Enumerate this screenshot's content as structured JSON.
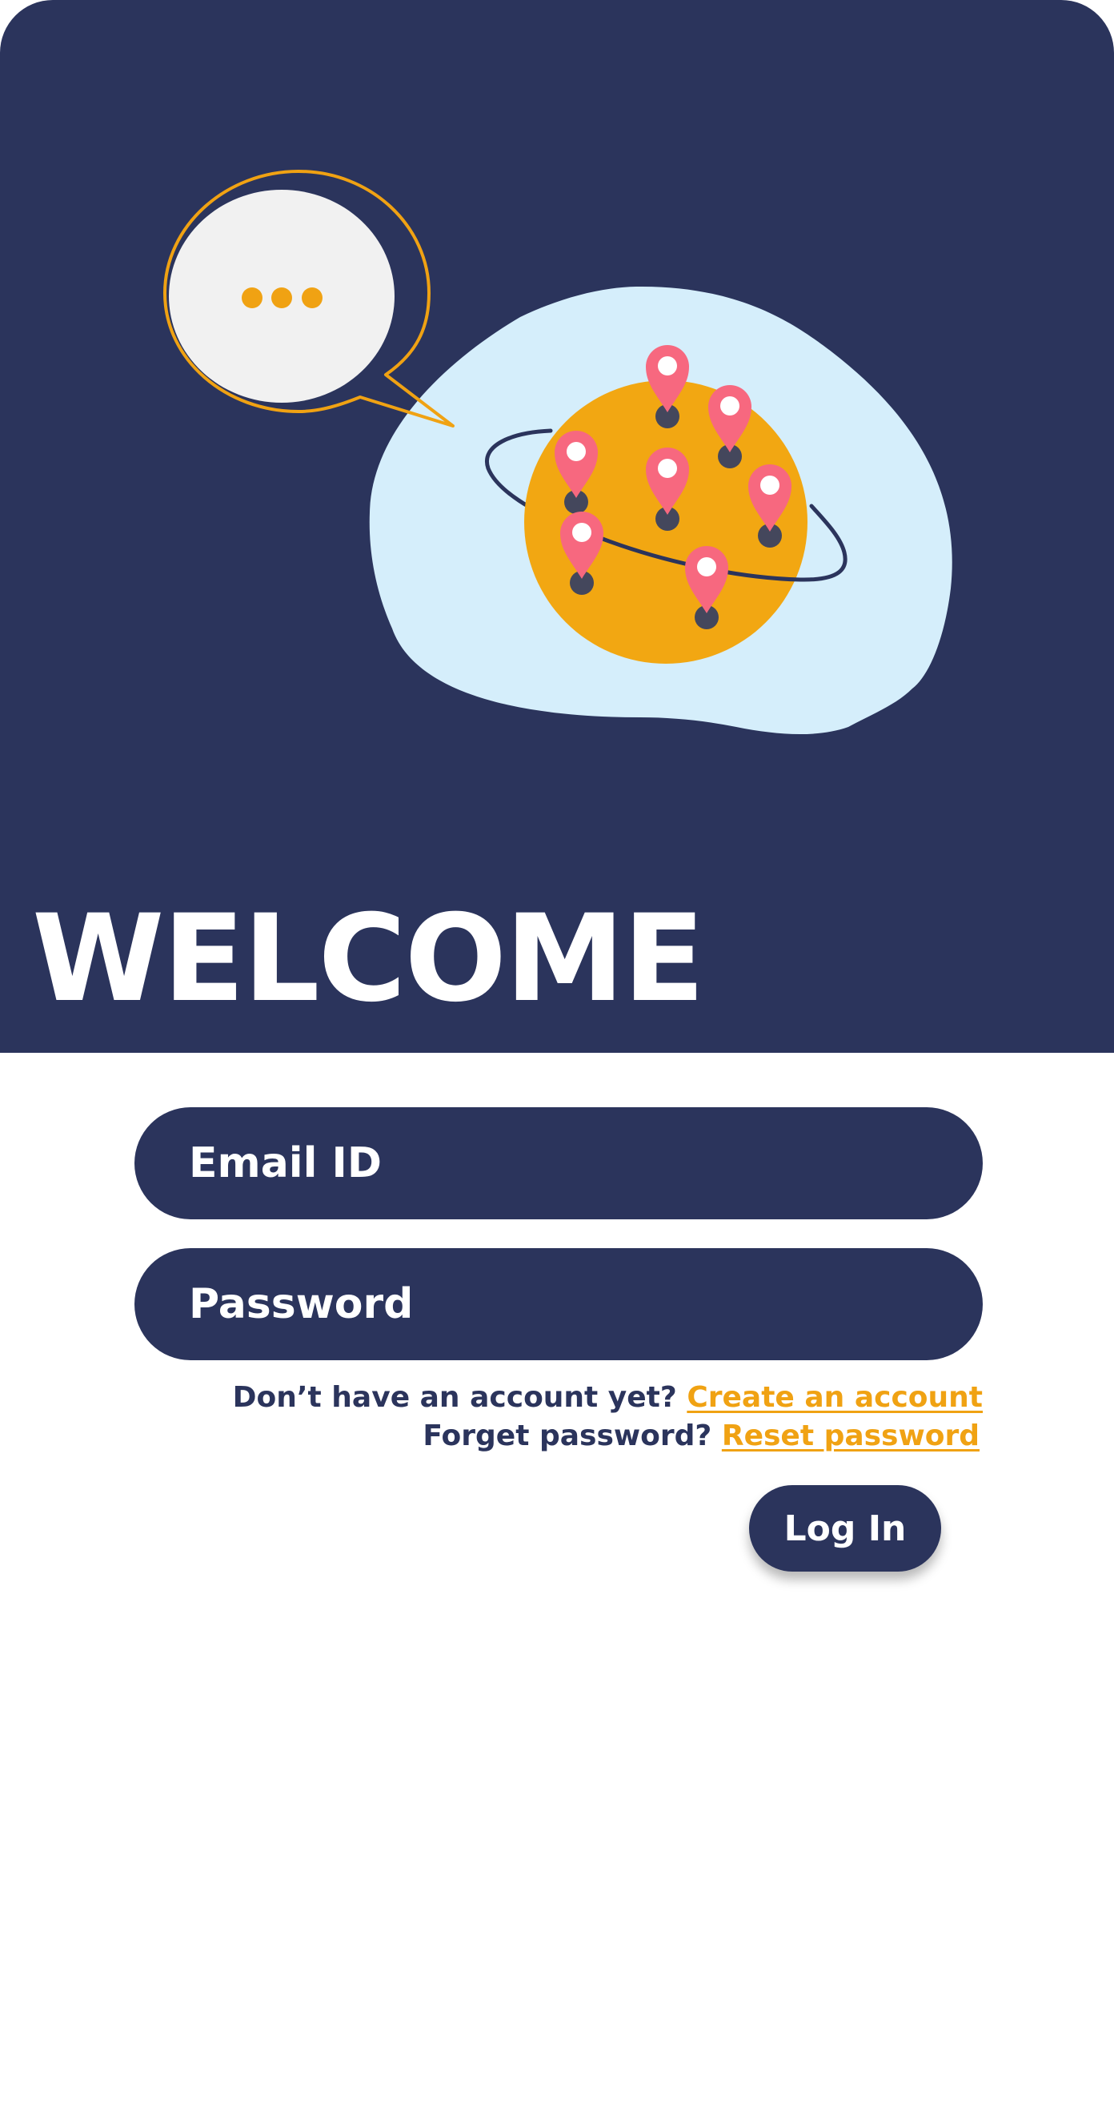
{
  "header": {
    "title": "WELCOME"
  },
  "illustration": {
    "icons": [
      "speech-bubble-icon",
      "typing-dots-icon",
      "globe-icon",
      "orbit-ring-icon",
      "map-pin-icon"
    ],
    "colors": {
      "background": "#2b345c",
      "blob": "#d5eefb",
      "globe": "#f2a712",
      "pin": "#f7687f",
      "bubble_fill": "#f1f1f1",
      "bubble_outline": "#f0a213"
    }
  },
  "form": {
    "email_placeholder": "Email ID",
    "password_placeholder": "Password",
    "signup_prompt": "Don’t have an account yet?",
    "signup_link": "Create an account",
    "forgot_prompt": "Forget password?",
    "reset_link": "Reset password",
    "login_label": "Log In"
  },
  "colors": {
    "primary": "#2b345c",
    "accent": "#f0a213",
    "background": "#ffffff"
  }
}
